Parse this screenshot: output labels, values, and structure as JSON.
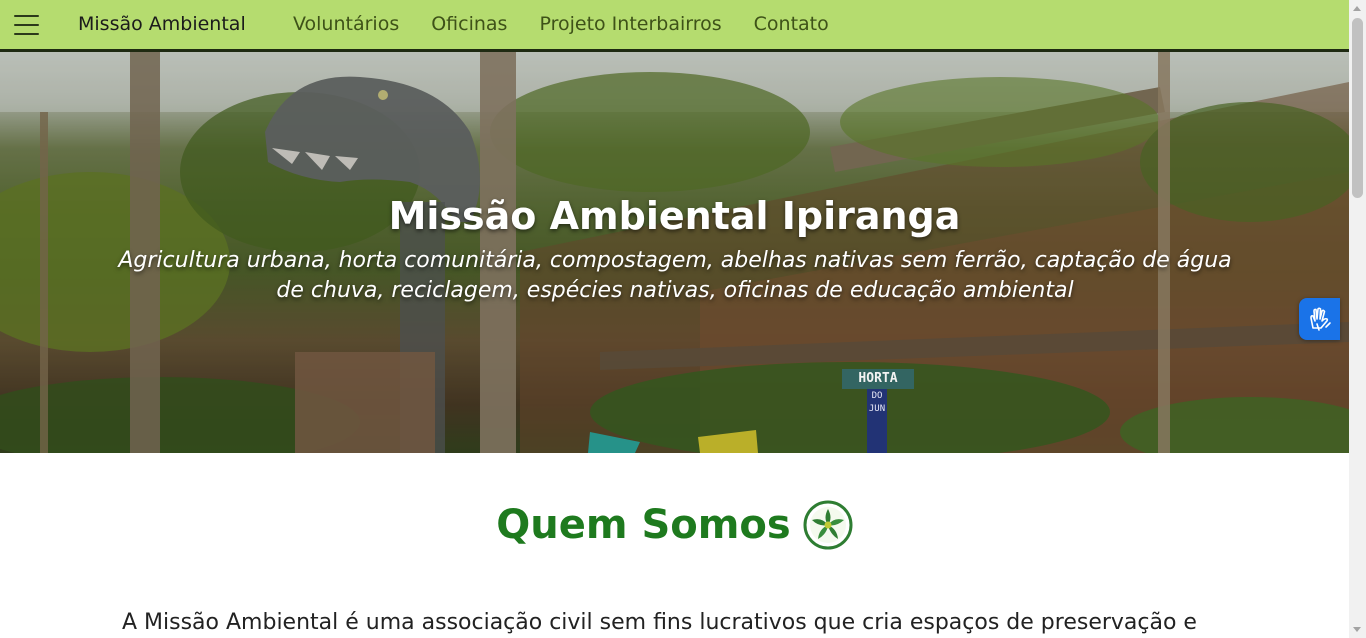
{
  "navbar": {
    "brand": "Missão Ambiental",
    "links": [
      "Voluntários",
      "Oficinas",
      "Projeto Interbairros",
      "Contato"
    ],
    "background": "#b5dc6f"
  },
  "hero": {
    "title": "Missão Ambiental Ipiranga",
    "subtitle": "Agricultura urbana, horta comunitária, compostagem, abelhas nativas sem ferrão, captação de água de chuva, reciclagem, espécies nativas, oficinas de educação ambiental",
    "sign_lines": [
      "HORTA",
      "DO",
      "JUN"
    ]
  },
  "about": {
    "heading": "Quem Somos",
    "text": "A Missão Ambiental é uma associação civil sem fins lucrativos que cria espaços de preservação e"
  },
  "colors": {
    "accent_green": "#1e7a1e",
    "a11y_blue": "#1a73e8"
  },
  "icons": {
    "menu": "hamburger-icon",
    "accessibility": "sign-language-hands-icon",
    "logo": "leaf-star-logo-icon"
  }
}
